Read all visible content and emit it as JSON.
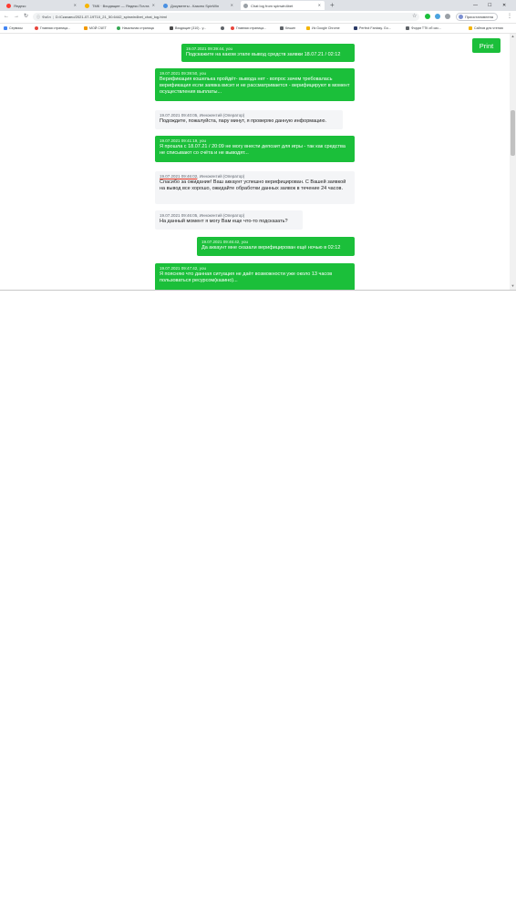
{
  "browser": {
    "tabs": [
      {
        "title": "Яндекс",
        "color": "#ff3b30"
      },
      {
        "title": "ТМК · Входящие — Яндекс.Почта",
        "color": "#f7b500"
      },
      {
        "title": "Документы - Казино SpinWin",
        "color": "#4a90e2"
      },
      {
        "title": "Chat log from spinwin4bet",
        "color": "#9aa0a6"
      }
    ],
    "address_label": "Файл",
    "address": "D:/Скачано/2021-07-19T10_21_50.6442_spinwin4bet_chat_log.html",
    "profile_label": "Приостановлена",
    "bookmarks": [
      {
        "title": "Сервисы",
        "color": "#4285f4"
      },
      {
        "title": "Главная страница...",
        "color": "#e8453c"
      },
      {
        "title": "МОЙ СЧЕТ",
        "color": "#f29900"
      },
      {
        "title": "Начальная страница",
        "color": "#34a853"
      },
      {
        "title": "Входящие (310) - у...",
        "color": "#4a4a4a"
      },
      {
        "title": "",
        "color": "#5f6368"
      },
      {
        "title": "Главная страница...",
        "color": "#e8453c"
      },
      {
        "title": "Кешин",
        "color": "#5f6368"
      },
      {
        "title": "Из Google Chrome",
        "color": "#f4b400"
      },
      {
        "title": "Perfect Fantasy. Go...",
        "color": "#2b3a67"
      },
      {
        "title": "Форум ТТК об сис...",
        "color": "#5f6368"
      },
      {
        "title": "Сайтов для чтения",
        "color": "#f4b400"
      }
    ]
  },
  "page": {
    "print_label": "Print",
    "messages": [
      {
        "dir": "out",
        "meta": "19.07.2021 09:39:44, you",
        "text": "Подскажите на каком этапе вывод средств заявки 18.07.21 / 02:12"
      },
      {
        "dir": "out",
        "meta": "19.07.2021 09:39:50, you",
        "text": "Верификация кошелька пройдёт- вывода нет - вопрос зачем требовалась верификация если заявка висит и не рассматривается - верифицируют в момент осуществления выплаты..."
      },
      {
        "dir": "in",
        "meta": "19.07.2021 09:40:05, Иннокентий (Оператор)",
        "text": "Подождите, пожалуйста, пару минут, я проверяю данную информацию."
      },
      {
        "dir": "out",
        "meta": "19.07.2021 09:41:19, you",
        "text": "Я прошла с 18.07.21 / 20:09 не могу внести депозит для игры - так как средства не списывают со счёта и не выводят..."
      },
      {
        "dir": "in",
        "meta_a": "19.07.2021 09:46:02",
        "meta_b": ", Иннокентий (Оператор)",
        "text": "Спасибо за ожидание! Ваш аккаунт успешно верифицирован. С Вашей заявкой на вывод все хорошо, ожидайте обработки данных заявок в течение 24 часов."
      },
      {
        "dir": "in",
        "meta": "19.07.2021 09:46:05, Иннокентий (Оператор)",
        "text": "На данный момент я могу Вам еще что-то подсказать?"
      },
      {
        "dir": "out",
        "meta": "19.07.2021 09:46:42, you",
        "text": "Да аккаунт мне сказали верифицирован ещё ночью в 02:12"
      },
      {
        "dir": "out",
        "meta": "19.07.2021 09:47:42, you",
        "text": "Я поясняю что данная ситуация не даёт возможности уже около 13 часов пользоваться ресурсом(казино)..."
      }
    ]
  }
}
